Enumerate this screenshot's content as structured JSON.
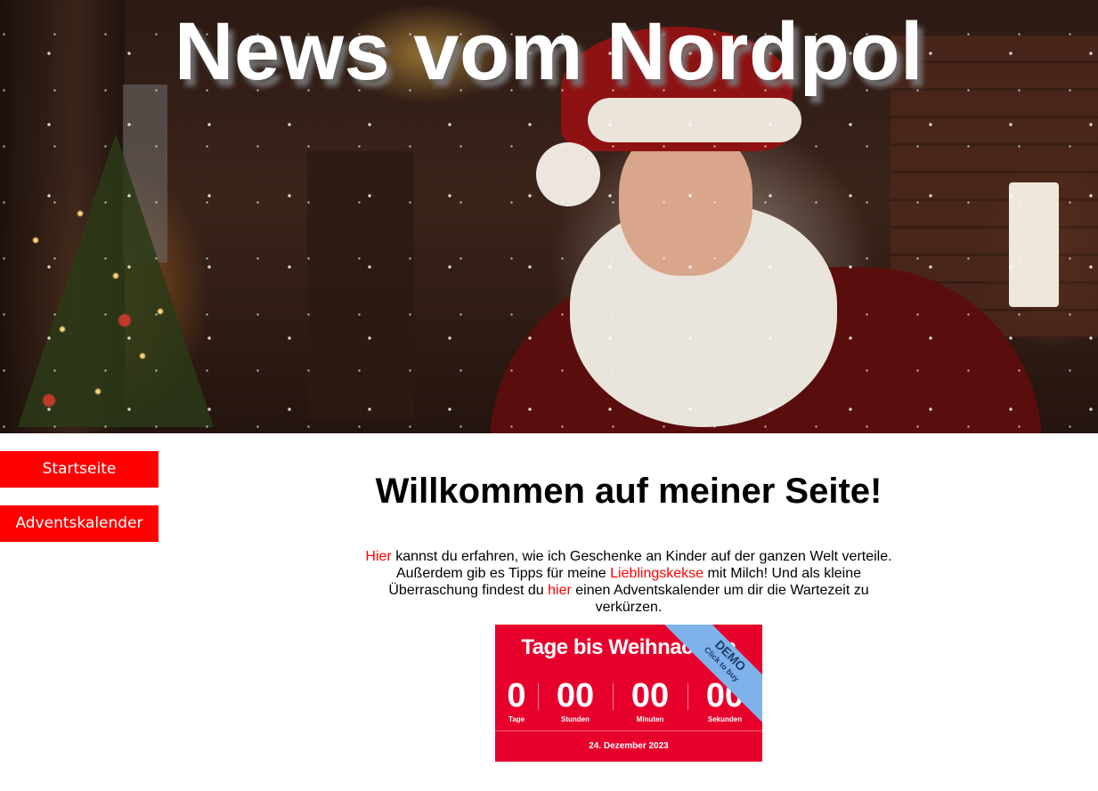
{
  "header": {
    "title": "News vom Nordpol"
  },
  "nav": {
    "items": [
      {
        "label": "Startseite"
      },
      {
        "label": "Adventskalender"
      }
    ]
  },
  "main": {
    "heading": "Willkommen auf meiner Seite!",
    "intro": {
      "link1": "Hier",
      "text1": " kannst du erfahren, wie ich Geschenke an Kinder auf der ganzen Welt verteile. Außerdem gib es Tipps für meine ",
      "link2": "Lieblingskekse",
      "text2": " mit Milch! Und als kleine Überraschung findest du ",
      "link3": "hier",
      "text3": " einen Adventskalender um dir die Wartezeit zu verkürzen."
    }
  },
  "countdown": {
    "title": "Tage bis Weihnachten",
    "units": [
      {
        "value": "0",
        "label": "Tage"
      },
      {
        "value": "00",
        "label": "Stunden"
      },
      {
        "value": "00",
        "label": "Minuten"
      },
      {
        "value": "00",
        "label": "Sekunden"
      }
    ],
    "date": "24. Dezember 2023",
    "ribbon": {
      "line1": "DEMO",
      "line2": "Click to buy"
    }
  },
  "colors": {
    "nav_bg": "#ff0000",
    "link": "#ff0000",
    "widget_bg": "#e8002d",
    "ribbon_bg": "#7fb2ea"
  }
}
